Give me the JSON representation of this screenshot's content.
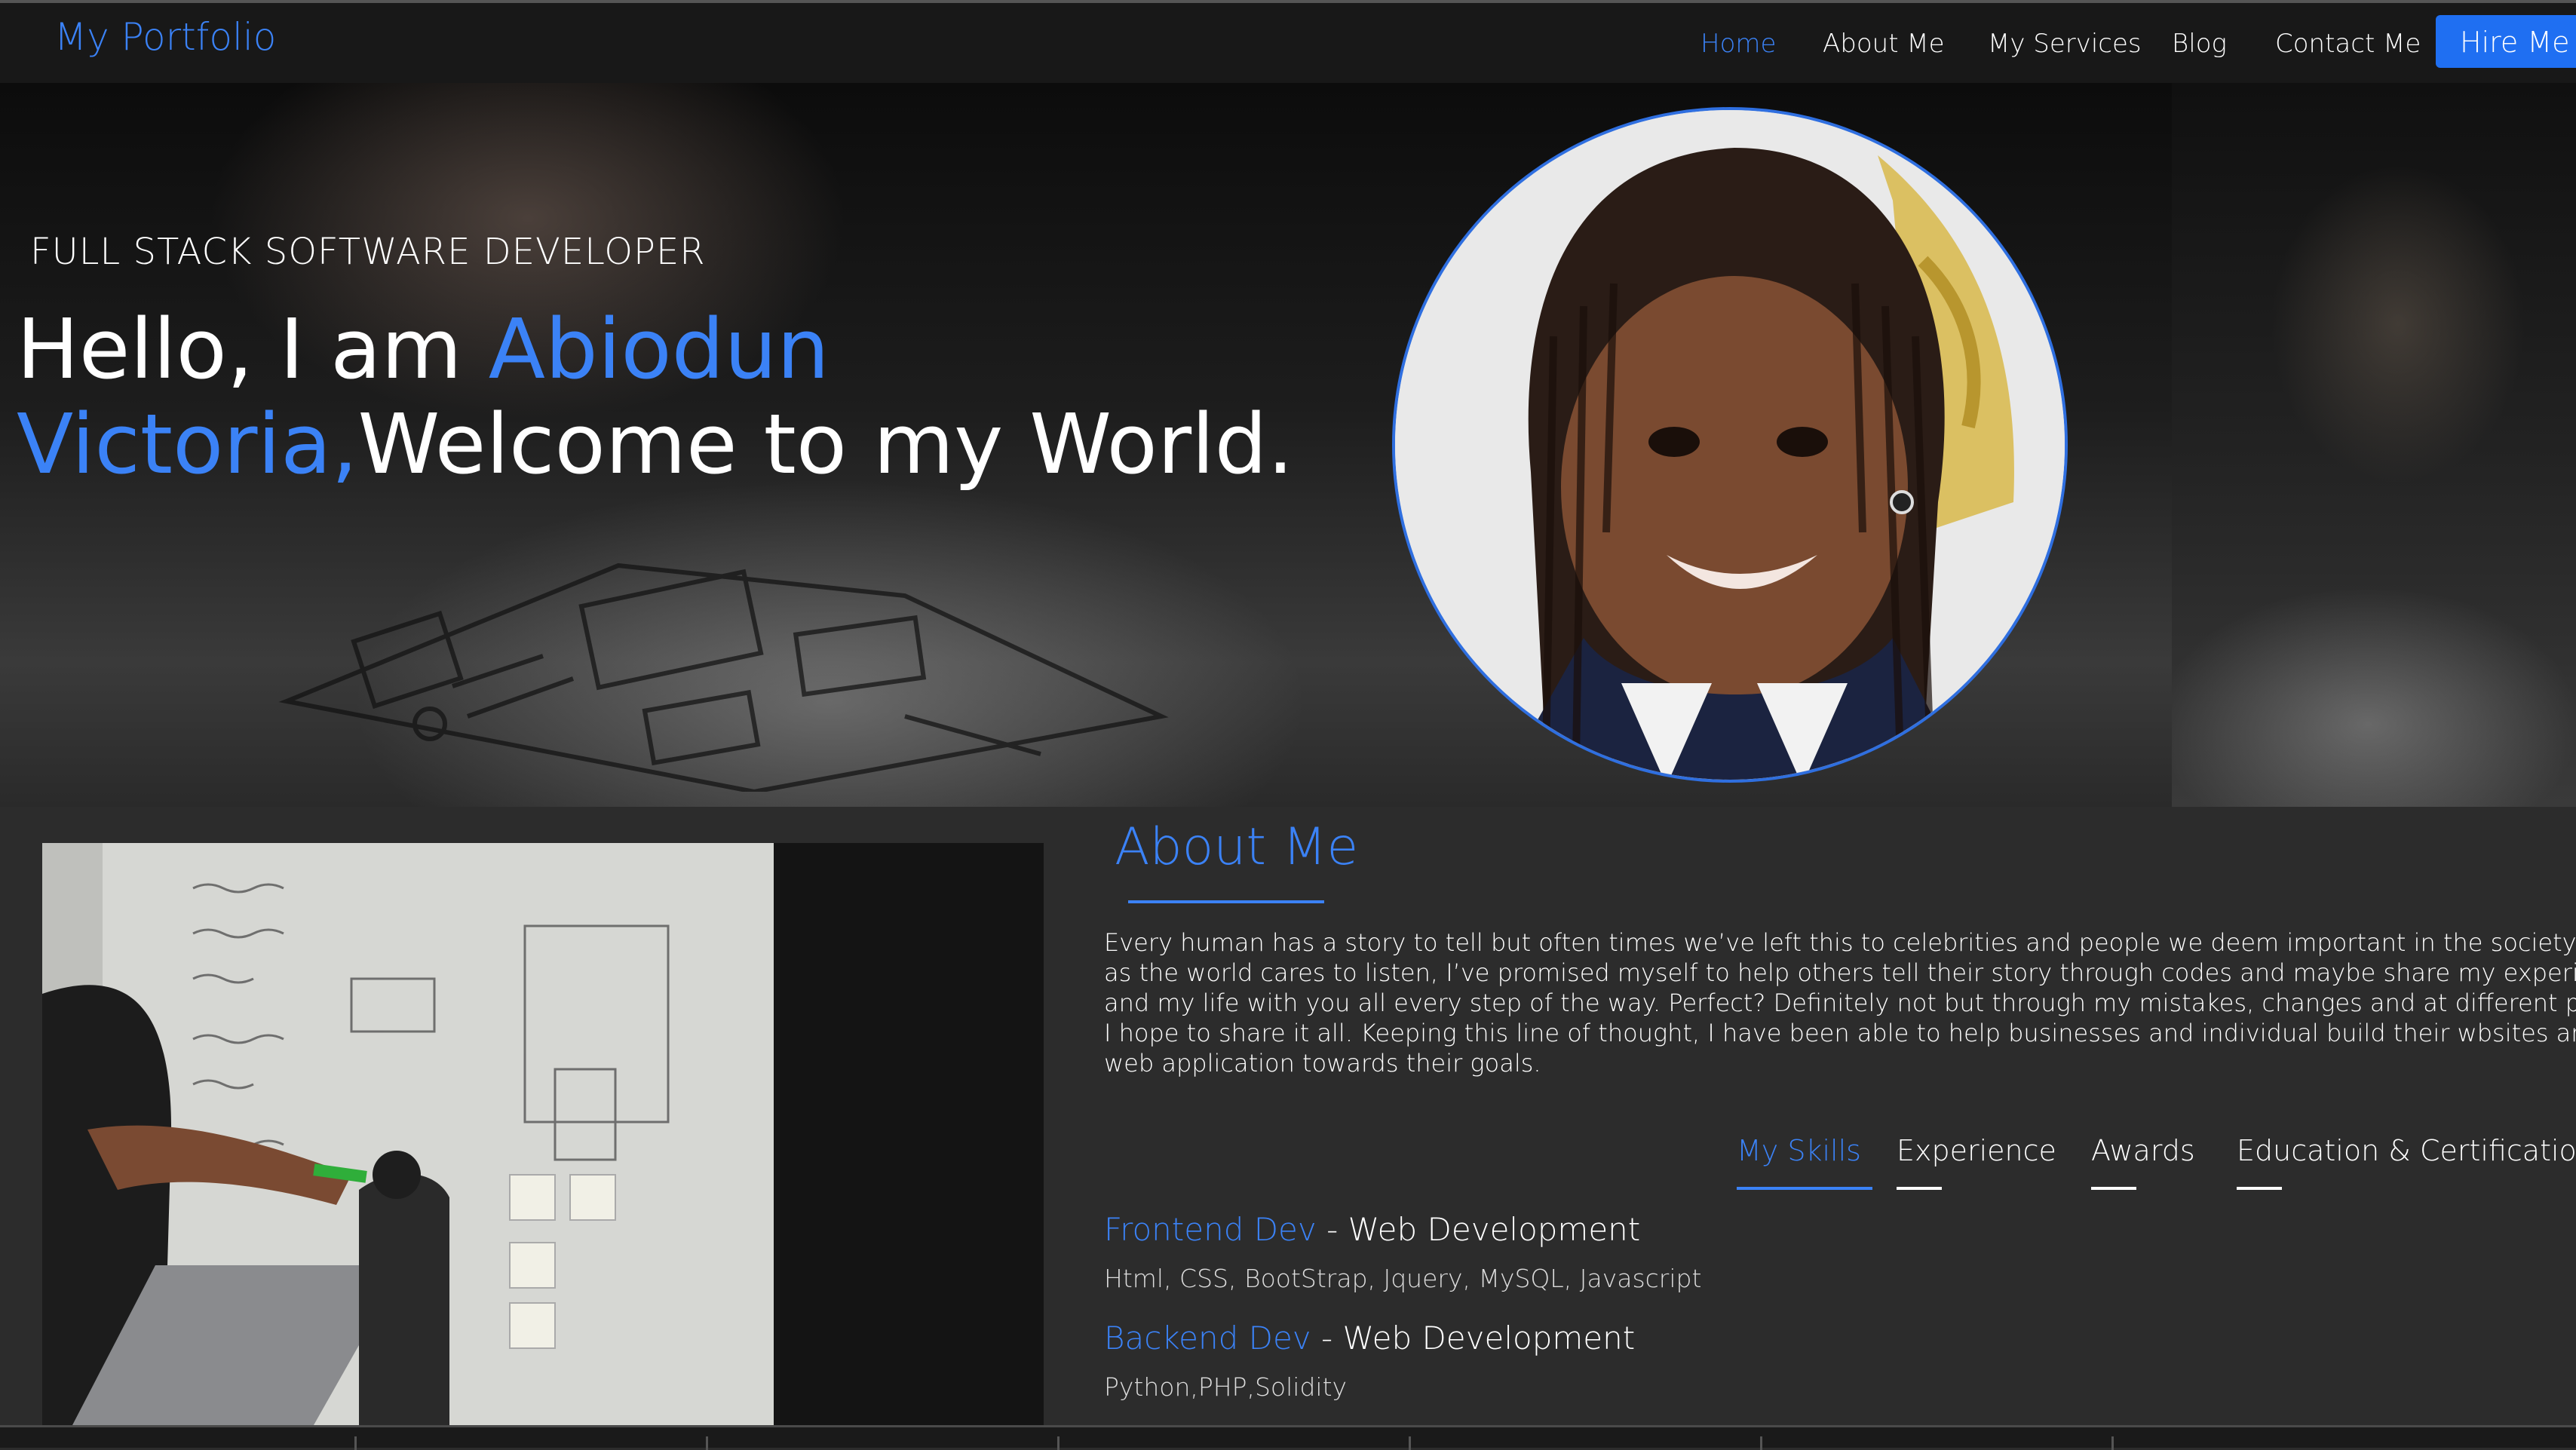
{
  "nav": {
    "brand": "My Portfolio",
    "items": [
      {
        "label": "Home",
        "active": true
      },
      {
        "label": "About Me",
        "active": false
      },
      {
        "label": "My Services",
        "active": false
      },
      {
        "label": "Blog",
        "active": false
      },
      {
        "label": "Contact Me",
        "active": false
      }
    ],
    "hire_label": "Hire Me"
  },
  "hero": {
    "subtitle": "FULL STACK SOFTWARE DEVELOPER",
    "greeting": "Hello, I am ",
    "name": "Abiodun Victoria,",
    "welcome": "Welcome to my World."
  },
  "about": {
    "heading": "About Me",
    "paragraph_lines": [
      "Every human has a story to tell but often times we’ve left this to celebrities and people we deem important in the society. As fa",
      "as the world cares to listen, I’ve promised myself to help others tell their story through codes and maybe share my experiences",
      "and my life with you all every step of the way. Perfect? Definitely not but through my mistakes, changes and at different phase",
      "I hope to share it all. Keeping this line of thought, I have been able to help businesses and individual build their wbsites and",
      "web application towards their goals."
    ]
  },
  "tabs": [
    {
      "label": "My Skills",
      "active": true
    },
    {
      "label": "Experience",
      "active": false
    },
    {
      "label": "Awards",
      "active": false
    },
    {
      "label": "Education & Certification",
      "active": false
    }
  ],
  "skills": [
    {
      "title": "Frontend Dev",
      "separator": " - ",
      "category": "Web Development",
      "detail": "Html, CSS, BootStrap, Jquery, MySQL, Javascript"
    },
    {
      "title": "Backend Dev",
      "separator": " - ",
      "category": "Web Development",
      "detail": "Python,PHP,Solidity"
    }
  ],
  "colors": {
    "accent": "#3b82f6",
    "button": "#1f6ff2",
    "nav_background": "#181818",
    "section_background": "#2c2c2c"
  },
  "icons": {
    "hero_background": "sketch-wireframe-photo",
    "avatar": "profile-photo",
    "about_image": "whiteboard-planning-photo"
  }
}
